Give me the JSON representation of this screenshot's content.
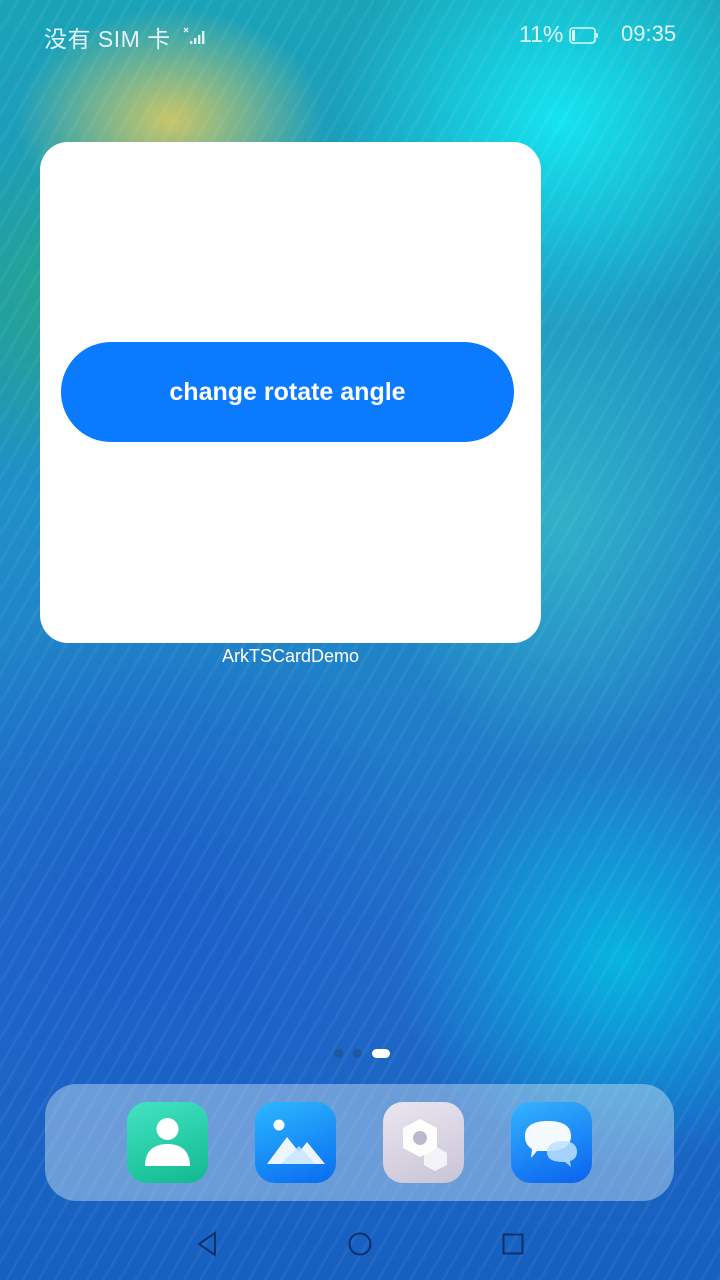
{
  "status_bar": {
    "carrier": "没有 SIM 卡",
    "signal_icon": "signal-x-icon",
    "battery_percent": "11%",
    "battery_icon": "battery-icon",
    "time": "09:35"
  },
  "widget": {
    "button_label": "change rotate angle",
    "caption": "ArkTSCardDemo",
    "button_color": "#0a7bff"
  },
  "pager": {
    "page_count": 3,
    "active_index": 2
  },
  "dock": {
    "apps": [
      {
        "icon": "contacts-icon"
      },
      {
        "icon": "gallery-icon"
      },
      {
        "icon": "services-icon"
      },
      {
        "icon": "messages-icon"
      }
    ]
  },
  "nav_bar": {
    "back_icon": "back-icon",
    "home_icon": "home-icon",
    "recents_icon": "recents-icon"
  }
}
